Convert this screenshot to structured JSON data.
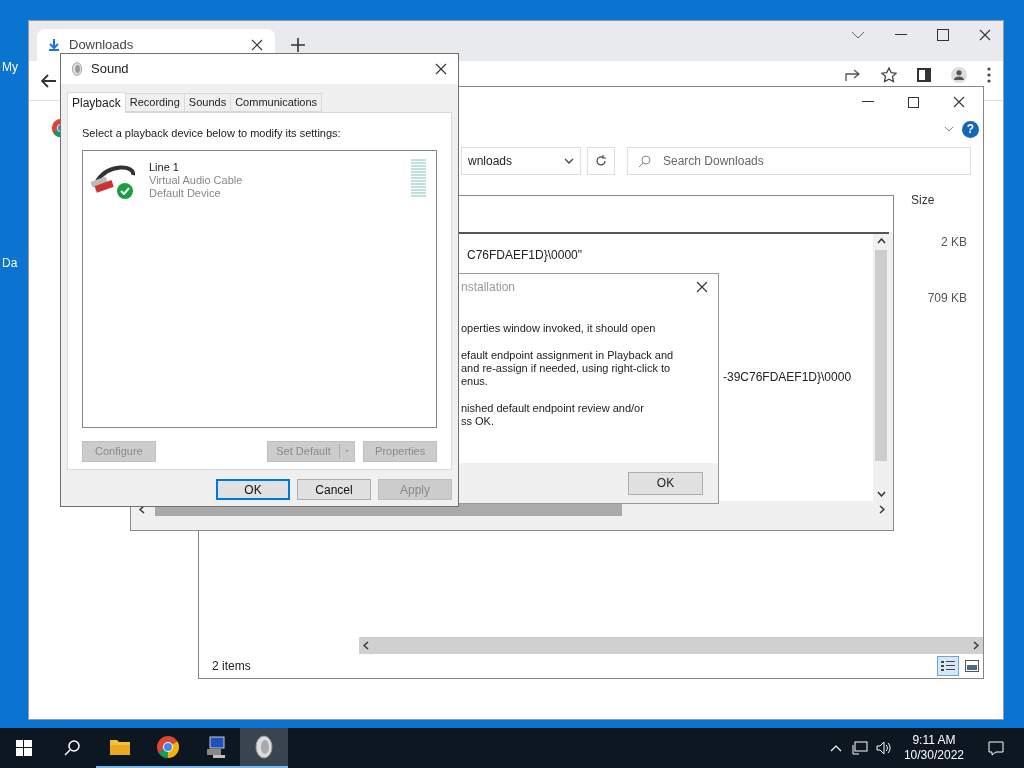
{
  "desktop": {
    "icon_labels": [
      "My",
      "Da"
    ]
  },
  "browser": {
    "tab_title": "Downloads"
  },
  "explorer": {
    "help": "?",
    "address": "wnloads",
    "search": {
      "placeholder": "Search Downloads"
    },
    "columns": [
      "Size"
    ],
    "rows": [
      {
        "size": "2 KB"
      },
      {
        "size": "709 KB"
      }
    ],
    "status": "2 items"
  },
  "log_window": {
    "lines": [
      "C76FDAEF1D}\\0000\"",
      "-39C76FDAEF1D}\\0000"
    ]
  },
  "install_dialog": {
    "title": "nstallation",
    "paragraphs": [
      "operties window invoked, it should open",
      "efault endpoint assignment in Playback and\nand re-assign if needed, using right-click to\nenus.",
      "nished default endpoint review and/or\nss OK."
    ],
    "button": "OK"
  },
  "sound": {
    "title": "Sound",
    "tabs": [
      {
        "label": "Playback",
        "selected": true
      },
      {
        "label": "Recording",
        "selected": false
      },
      {
        "label": "Sounds",
        "selected": false
      },
      {
        "label": "Communications",
        "selected": false
      }
    ],
    "instruction": "Select a playback device below to modify its settings:",
    "devices": [
      {
        "name": "Line 1",
        "description": "Virtual Audio Cable",
        "status": "Default Device",
        "default": true
      }
    ],
    "actions": [
      {
        "label": "Configure",
        "disabled": true
      },
      {
        "label": "Set Default",
        "disabled": true,
        "kind": "split"
      },
      {
        "label": "Properties",
        "disabled": true
      }
    ],
    "buttons": [
      {
        "label": "OK",
        "disabled": false,
        "focused": true
      },
      {
        "label": "Cancel",
        "disabled": false,
        "focused": false
      },
      {
        "label": "Apply",
        "disabled": true,
        "focused": false
      }
    ]
  },
  "taskbar": {
    "apps": [
      {
        "kind": "folder",
        "active": false
      },
      {
        "kind": "chrome",
        "active": false
      },
      {
        "kind": "computer",
        "active": false
      },
      {
        "kind": "speaker",
        "active": true
      }
    ],
    "time": "9:11 AM",
    "date": "10/30/2022"
  }
}
